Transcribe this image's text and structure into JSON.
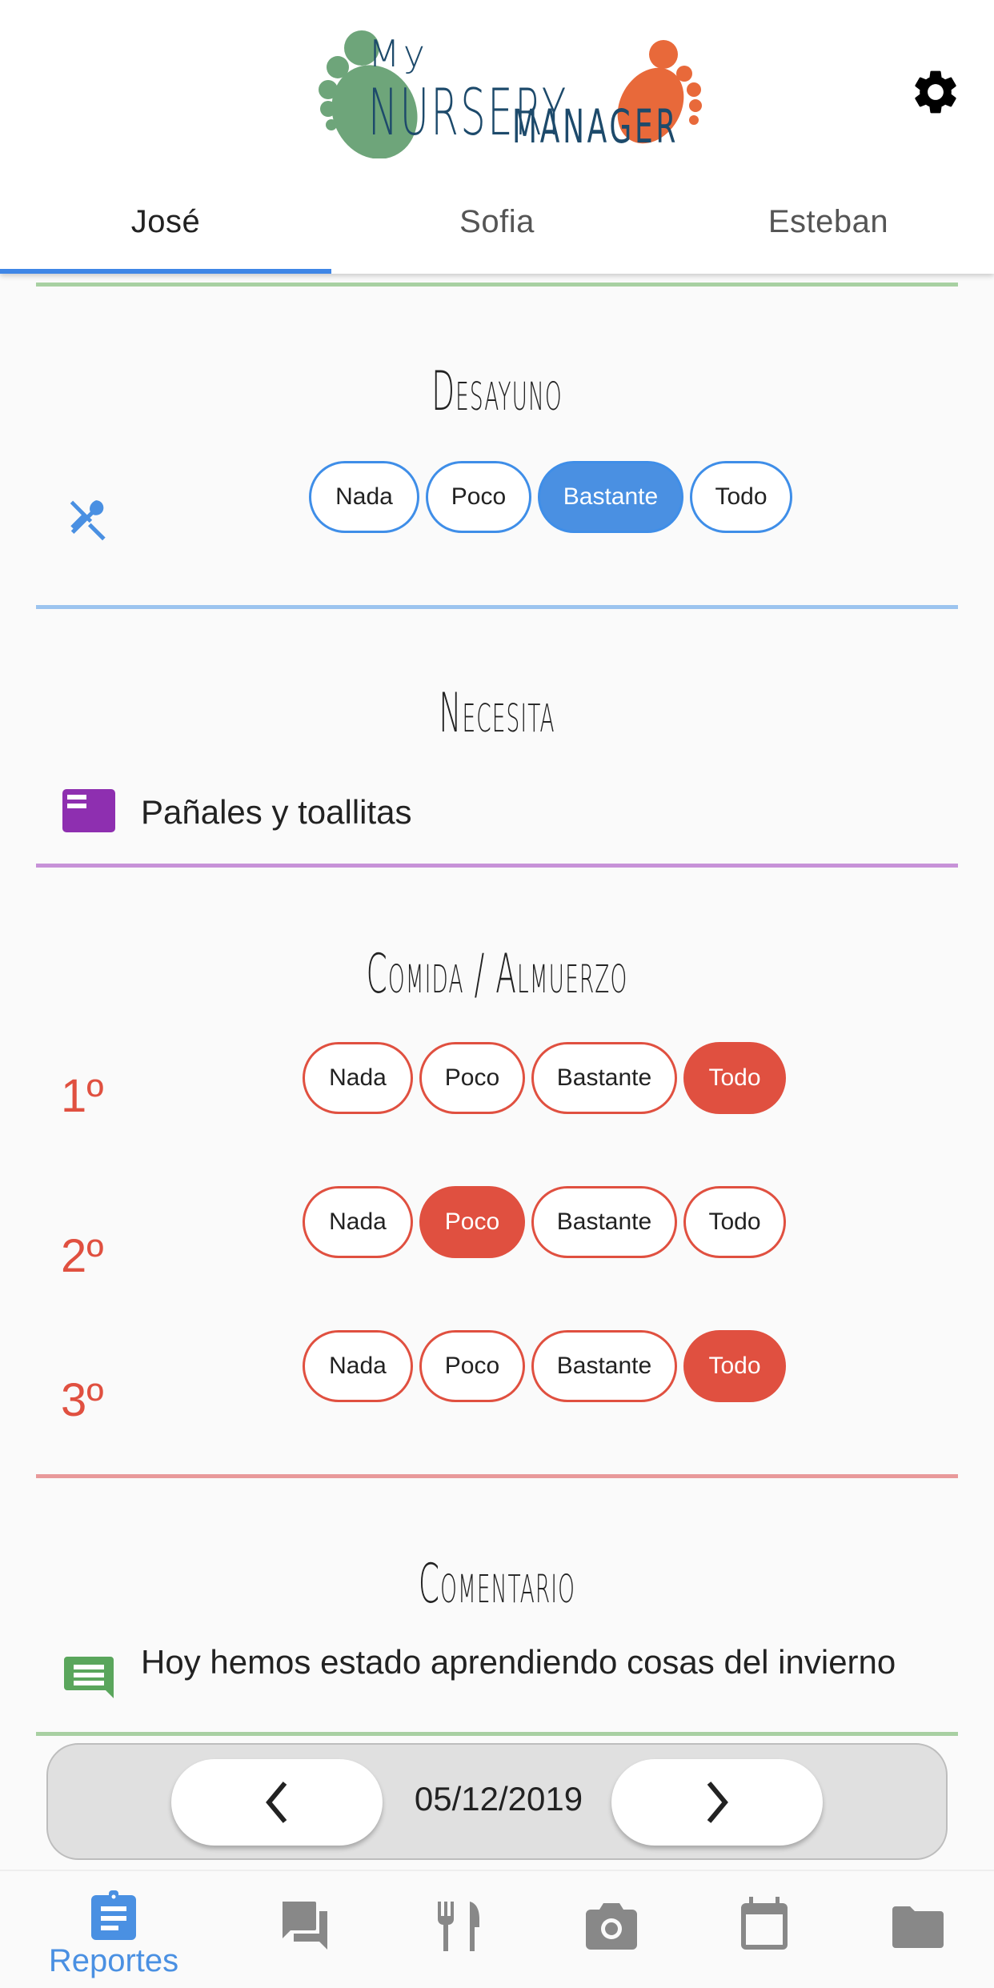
{
  "app": {
    "logo_text_line1_small": "My",
    "logo_text_line1_big": "NURSERY",
    "logo_text_line2": "MANAGER"
  },
  "header": {
    "settings_icon": "gear-icon",
    "tabs": [
      {
        "label": "José",
        "active": true
      },
      {
        "label": "Sofia",
        "active": false
      },
      {
        "label": "Esteban",
        "active": false
      }
    ]
  },
  "colors": {
    "accent_blue": "#4a90e2",
    "accent_red": "#e05040",
    "purple": "#8e2fb0",
    "green": "#5aa65c",
    "sep_green": "#a8d0a2",
    "sep_blue": "#9cc4ef",
    "sep_purple": "#c792d8",
    "sep_red": "#e8999a"
  },
  "sections": {
    "desayuno": {
      "title": "Desayuno",
      "icon": "cutlery-icon",
      "options": [
        "Nada",
        "Poco",
        "Bastante",
        "Todo"
      ],
      "selected": "Bastante"
    },
    "necesita": {
      "title": "Necesita",
      "icon": "note-icon",
      "text": "Pañales y toallitas"
    },
    "comida": {
      "title": "Comida / Almuerzo",
      "courses": [
        {
          "label": "1º",
          "options": [
            "Nada",
            "Poco",
            "Bastante",
            "Todo"
          ],
          "selected": "Todo"
        },
        {
          "label": "2º",
          "options": [
            "Nada",
            "Poco",
            "Bastante",
            "Todo"
          ],
          "selected": "Poco"
        },
        {
          "label": "3º",
          "options": [
            "Nada",
            "Poco",
            "Bastante",
            "Todo"
          ],
          "selected": "Todo"
        }
      ]
    },
    "comentario": {
      "title": "Comentario",
      "icon": "comment-icon",
      "text": "Hoy hemos estado aprendiendo cosas del invierno"
    }
  },
  "date_nav": {
    "date": "05/12/2019",
    "prev_icon": "chevron-left-icon",
    "next_icon": "chevron-right-icon"
  },
  "bottom_nav": {
    "items": [
      {
        "label": "Reportes",
        "icon": "clipboard-icon",
        "active": true
      },
      {
        "label": "",
        "icon": "chat-icon",
        "active": false
      },
      {
        "label": "",
        "icon": "restaurant-icon",
        "active": false
      },
      {
        "label": "",
        "icon": "camera-icon",
        "active": false
      },
      {
        "label": "",
        "icon": "calendar-icon",
        "active": false
      },
      {
        "label": "",
        "icon": "folder-icon",
        "active": false
      }
    ]
  }
}
